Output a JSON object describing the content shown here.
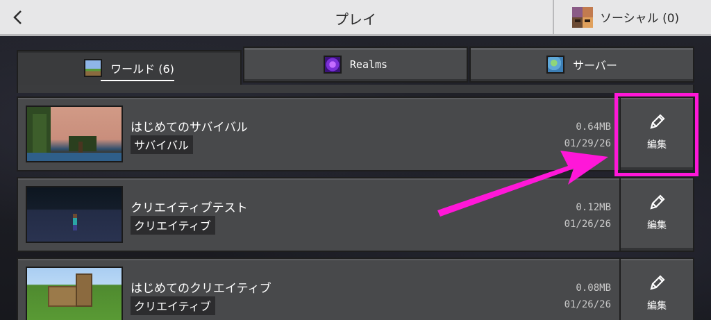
{
  "header": {
    "back_glyph": "‹",
    "title": "プレイ",
    "social_label": "ソーシャル (0)"
  },
  "tabs": [
    {
      "label": "ワールド (6)",
      "icon": "world-icon",
      "active": true
    },
    {
      "label": "Realms",
      "icon": "realms-icon",
      "active": false
    },
    {
      "label": "サーバー",
      "icon": "server-globe-icon",
      "active": false
    }
  ],
  "worlds": [
    {
      "name": "はじめてのサバイバル",
      "mode": "サバイバル",
      "size": "0.64MB",
      "date": "01/29/26",
      "edit_label": "編集"
    },
    {
      "name": "クリエイティブテスト",
      "mode": "クリエイティブ",
      "size": "0.12MB",
      "date": "01/26/26",
      "edit_label": "編集"
    },
    {
      "name": "はじめてのクリエイティブ",
      "mode": "クリエイティブ",
      "size": "0.08MB",
      "date": "01/26/26",
      "edit_label": "編集"
    }
  ],
  "colors": {
    "highlight": "#ff17d8",
    "header_bg": "#e7e7e8",
    "row_bg": "#48494b"
  }
}
